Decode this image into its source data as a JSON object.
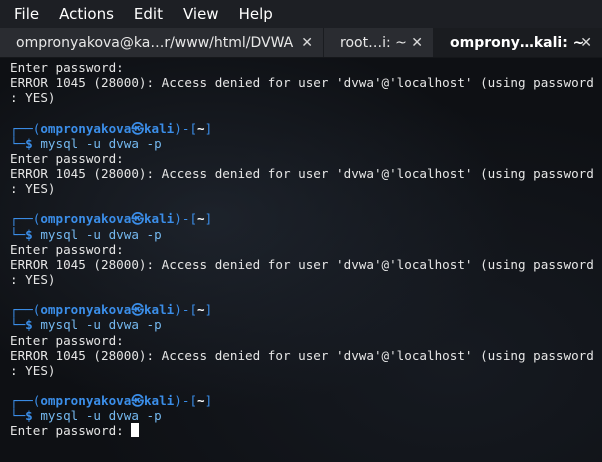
{
  "menu": [
    "File",
    "Actions",
    "Edit",
    "View",
    "Help"
  ],
  "tabs": [
    {
      "label": "ompronyakova@ka…r/www/html/DVWA",
      "close": "✕"
    },
    {
      "label": "root…i: ~",
      "close": "✕"
    },
    {
      "label": "ompronу…kali: ~",
      "close": "✕"
    }
  ],
  "terminal": {
    "prompt_user": "ompronyakova",
    "prompt_at": "㉿",
    "prompt_host": "kali",
    "prompt_cwd": "~",
    "command": "mysql -u dvwa -p",
    "password_prompt": "Enter password:",
    "error_line1": "ERROR 1045 (28000): Access denied for user 'dvwa'@'localhost' (using password",
    "error_line2": ": YES)"
  }
}
